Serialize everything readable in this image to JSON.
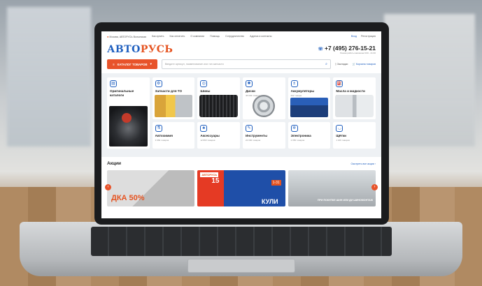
{
  "topbar": {
    "location": "Москва, АВТОРУСЬ Волынская",
    "links": [
      "Как купить",
      "Как оплатить",
      "О компании",
      "Помощь",
      "Сотрудничество",
      "Адреса и контакты"
    ],
    "login": "Вход",
    "register": "Регистрация"
  },
  "header": {
    "logo_a": "АВТО",
    "logo_b": "РУСЬ",
    "phone": "+7 (495) 276-15-21",
    "phone_hours": "Режим работы магазина 9:00 - 21:00"
  },
  "catbar": {
    "catalog_label": "КАТАЛОГ ТОВАРОВ",
    "search_placeholder": "Введите артикул, наименование или тип запчасти",
    "bookmarks": "Закладки",
    "cart": "Корзина товаров"
  },
  "categories": [
    {
      "title": "Оригинальные каталоги",
      "count": ""
    },
    {
      "title": "Запчасти для ТО",
      "count": ""
    },
    {
      "title": "Шины",
      "count": "21 244 товаров"
    },
    {
      "title": "Диски",
      "count": "45 603 товаров"
    },
    {
      "title": "Аккумуляторы",
      "count": "622 товара"
    },
    {
      "title": "Масла и жидкости",
      "count": "3 985 товаров"
    },
    {
      "title": "Автохимия",
      "count": "3 969 товаров"
    },
    {
      "title": "Аксессуары",
      "count": "12 893 товаров"
    },
    {
      "title": "Инструменты",
      "count": "22 000 товаров"
    },
    {
      "title": "Электроника",
      "count": "2 050 товаров"
    },
    {
      "title": "Щётки",
      "count": "1 169 товаров"
    }
  ],
  "promo": {
    "title": "Акции",
    "all_link": "Смотреть все акции",
    "banner1_text": "ДКА 50%",
    "banner2_logo": "АВТОРУСЬ",
    "banner2_num": "15",
    "banner2_word": "КУЛИ",
    "banner2_badge": "1-31",
    "banner3_text": "ПРИ ПОКУПКЕ ШИН ИЛИ ДИ ШИНОМОНТАЖ"
  },
  "icons": {
    "pin": "map-pin-icon",
    "phone": "phone-icon",
    "search": "search-icon",
    "bookmark": "bookmark-icon",
    "cart": "cart-icon",
    "arrows": "chevron-icon"
  },
  "colors": {
    "brand_blue": "#1f5fbf",
    "brand_orange": "#e55320"
  }
}
